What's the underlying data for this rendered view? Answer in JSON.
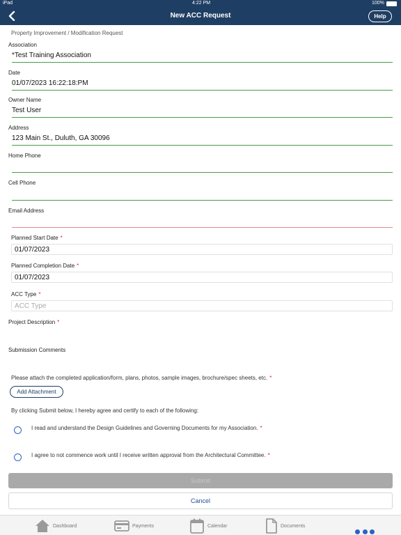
{
  "status_bar": {
    "device": "iPad",
    "time": "4:22 PM",
    "battery": "100%"
  },
  "nav": {
    "title": "New ACC Request",
    "help_label": "Help"
  },
  "form": {
    "header": "Property Improvement / Modification Request",
    "association": {
      "label": "Association",
      "value": "*Test Training Association"
    },
    "date": {
      "label": "Date",
      "value": "01/07/2023 16:22:18:PM"
    },
    "owner_name": {
      "label": "Owner Name",
      "value": "Test User"
    },
    "address": {
      "label": "Address",
      "value": "123 Main St., Duluth, GA 30096"
    },
    "home_phone": {
      "label": "Home Phone",
      "value": ""
    },
    "cell_phone": {
      "label": "Cell Phone",
      "value": ""
    },
    "email": {
      "label": "Email Address",
      "value": ""
    },
    "planned_start": {
      "label": "Planned Start Date",
      "value": "01/07/2023"
    },
    "planned_completion": {
      "label": "Planned Completion Date",
      "value": "01/07/2023"
    },
    "acc_type": {
      "label": "ACC Type",
      "placeholder": "ACC Type"
    },
    "project_description": {
      "label": "Project Description"
    },
    "submission_comments": {
      "label": "Submission Comments"
    },
    "required_marker": "*",
    "attach_note": "Please attach the completed application/form, plans, photos, sample images, brochure/spec sheets, etc.",
    "attach_button": "Add Attachment",
    "certify_note": "By clicking Submit below, I hereby agree and certify to each of the following:",
    "agreements": [
      "I read and understand the Design Guidelines and Governing Documents for my Association.",
      "I agree to not commence work until I receive written approval from the Architectural Committee."
    ],
    "submit_label": "Submit",
    "cancel_label": "Cancel"
  },
  "tabs": [
    {
      "label": "Dashboard",
      "icon": "house-icon"
    },
    {
      "label": "Payments",
      "icon": "credit-card-icon"
    },
    {
      "label": "Calendar",
      "icon": "calendar-icon"
    },
    {
      "label": "Documents",
      "icon": "document-icon"
    }
  ],
  "colors": {
    "brand": "#1f3e63",
    "accent": "#2a63c4",
    "valid_line": "#4a9a4a",
    "error_line": "#e58a8a"
  }
}
